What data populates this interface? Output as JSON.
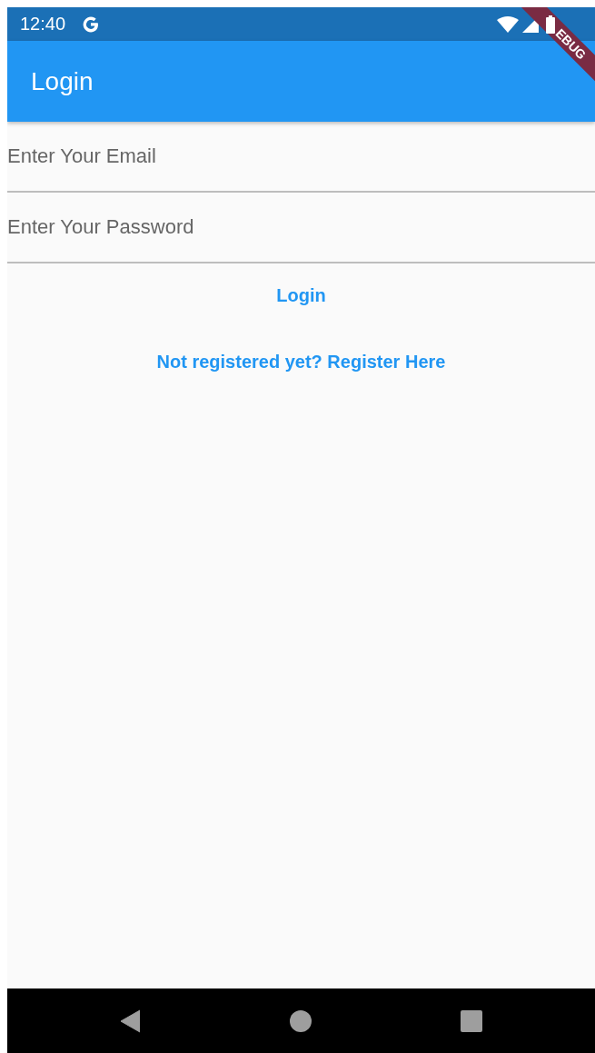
{
  "status_bar": {
    "time": "12:40"
  },
  "debug_banner": {
    "text": "EBUG"
  },
  "app_bar": {
    "title": "Login"
  },
  "fields": [
    {
      "placeholder": "Enter Your Email"
    },
    {
      "placeholder": "Enter Your Password"
    }
  ],
  "buttons": [
    {
      "label": "Login"
    },
    {
      "label": "Not registered yet? Register Here"
    }
  ]
}
